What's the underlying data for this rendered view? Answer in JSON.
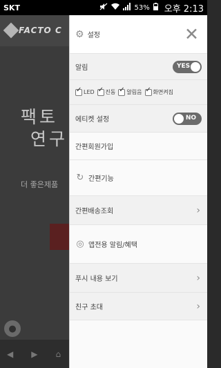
{
  "status_bar": {
    "carrier": "SKT",
    "battery": "53%",
    "time": "오후 2:13"
  },
  "background_app": {
    "logo": "FACTO C",
    "hero_line1": "팩토",
    "hero_line2": "연구",
    "subtitle": "더 좋은제품"
  },
  "drawer": {
    "header": {
      "title": "설정",
      "close": "✕"
    },
    "alarm": {
      "label": "알림",
      "toggle_text": "YES"
    },
    "options": [
      {
        "label": "LED",
        "checked": true
      },
      {
        "label": "진동",
        "checked": true
      },
      {
        "label": "알림음",
        "checked": true
      },
      {
        "label": "화면켜짐",
        "checked": true
      }
    ],
    "etiquette": {
      "label": "에티켓 설정",
      "toggle_text": "NO"
    },
    "menu": {
      "easy_signup": "간편회원가입",
      "easy_function": "간편기능",
      "easy_delivery": "간편배송조회",
      "app_notice": "앱전용 알림/혜택",
      "push_view": "푸시 내용 보기",
      "invite": "친구 초대"
    }
  }
}
